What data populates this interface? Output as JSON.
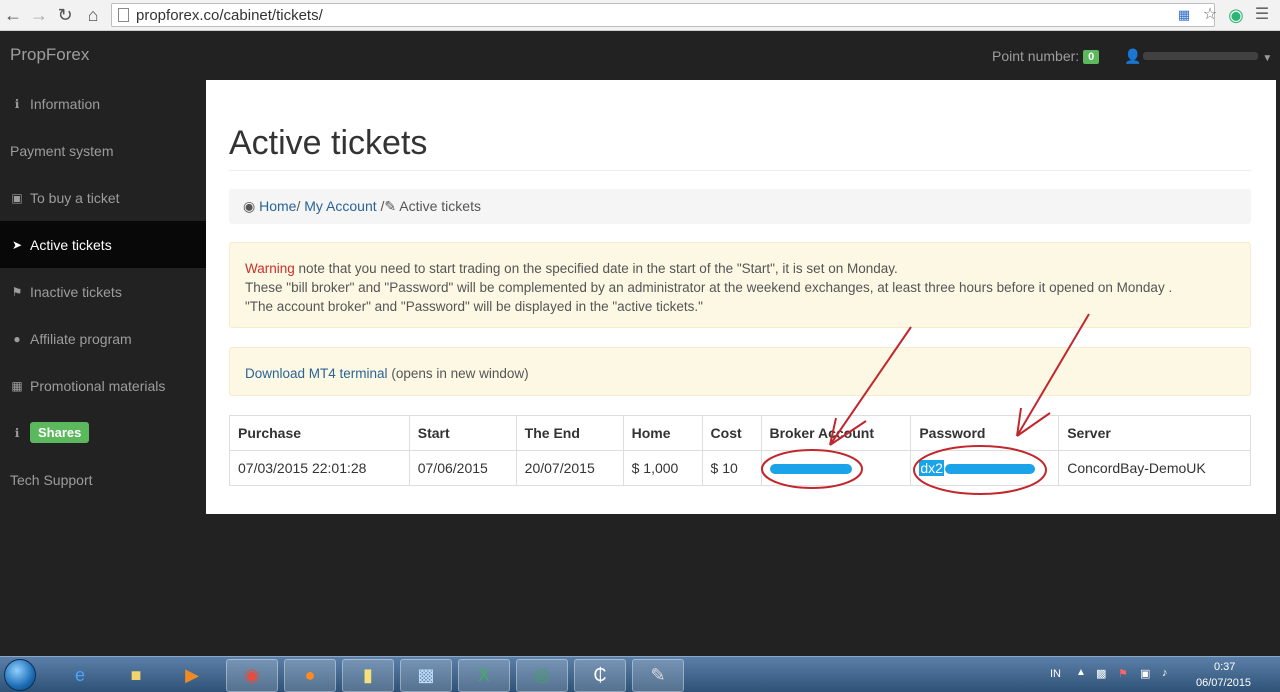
{
  "browser": {
    "url": "propforex.co/cabinet/tickets/"
  },
  "navbar": {
    "brand": "PropForex",
    "points_label": "Point number:",
    "points_value": "0"
  },
  "sidebar": {
    "items": [
      {
        "label": "Information",
        "icon": "info-icon"
      },
      {
        "label": "Payment system",
        "icon": ""
      },
      {
        "label": "To buy a ticket",
        "icon": "money-icon"
      },
      {
        "label": "Active tickets",
        "icon": "paper-plane-icon",
        "active": true
      },
      {
        "label": "Inactive tickets",
        "icon": "flag-icon"
      },
      {
        "label": "Affiliate program",
        "icon": "user-icon"
      },
      {
        "label": "Promotional materials",
        "icon": "image-icon"
      },
      {
        "label": "Shares",
        "icon": "info-icon",
        "badge": true
      },
      {
        "label": "Tech Support",
        "icon": ""
      }
    ]
  },
  "main": {
    "title": "Active tickets",
    "breadcrumb": {
      "home": "Home",
      "account": "My Account",
      "current": "Active tickets",
      "sep": "/"
    },
    "warning": {
      "label": "Warning",
      "line1": "note that you need to start trading on the specified date in the start of the \"Start\", it is set on Monday.",
      "line2": "These \"bill broker\" and \"Password\" will be complemented by an administrator at the weekend exchanges, at least three hours before it opened on Monday .",
      "line3": "\"The account broker\" and \"Password\" will be displayed in the \"active tickets.\""
    },
    "download": {
      "link": "Download MT4 terminal",
      "note": "(opens in new window)"
    },
    "table": {
      "headers": [
        "Purchase",
        "Start",
        "The End",
        "Home",
        "Cost",
        "Broker Account",
        "Password",
        "Server"
      ],
      "row": {
        "purchase": "07/03/2015 22:01:28",
        "start": "07/06/2015",
        "end": "20/07/2015",
        "home": "$ 1,000",
        "cost": "$ 10",
        "password_prefix": "dx2",
        "server": "ConcordBay-DemoUK"
      }
    }
  },
  "taskbar": {
    "lang": "IN",
    "time": "0:37",
    "date": "06/07/2015"
  },
  "colors": {
    "annotation": "#c1272d",
    "redaction": "#1aa3e8",
    "success": "#5cb85c"
  }
}
